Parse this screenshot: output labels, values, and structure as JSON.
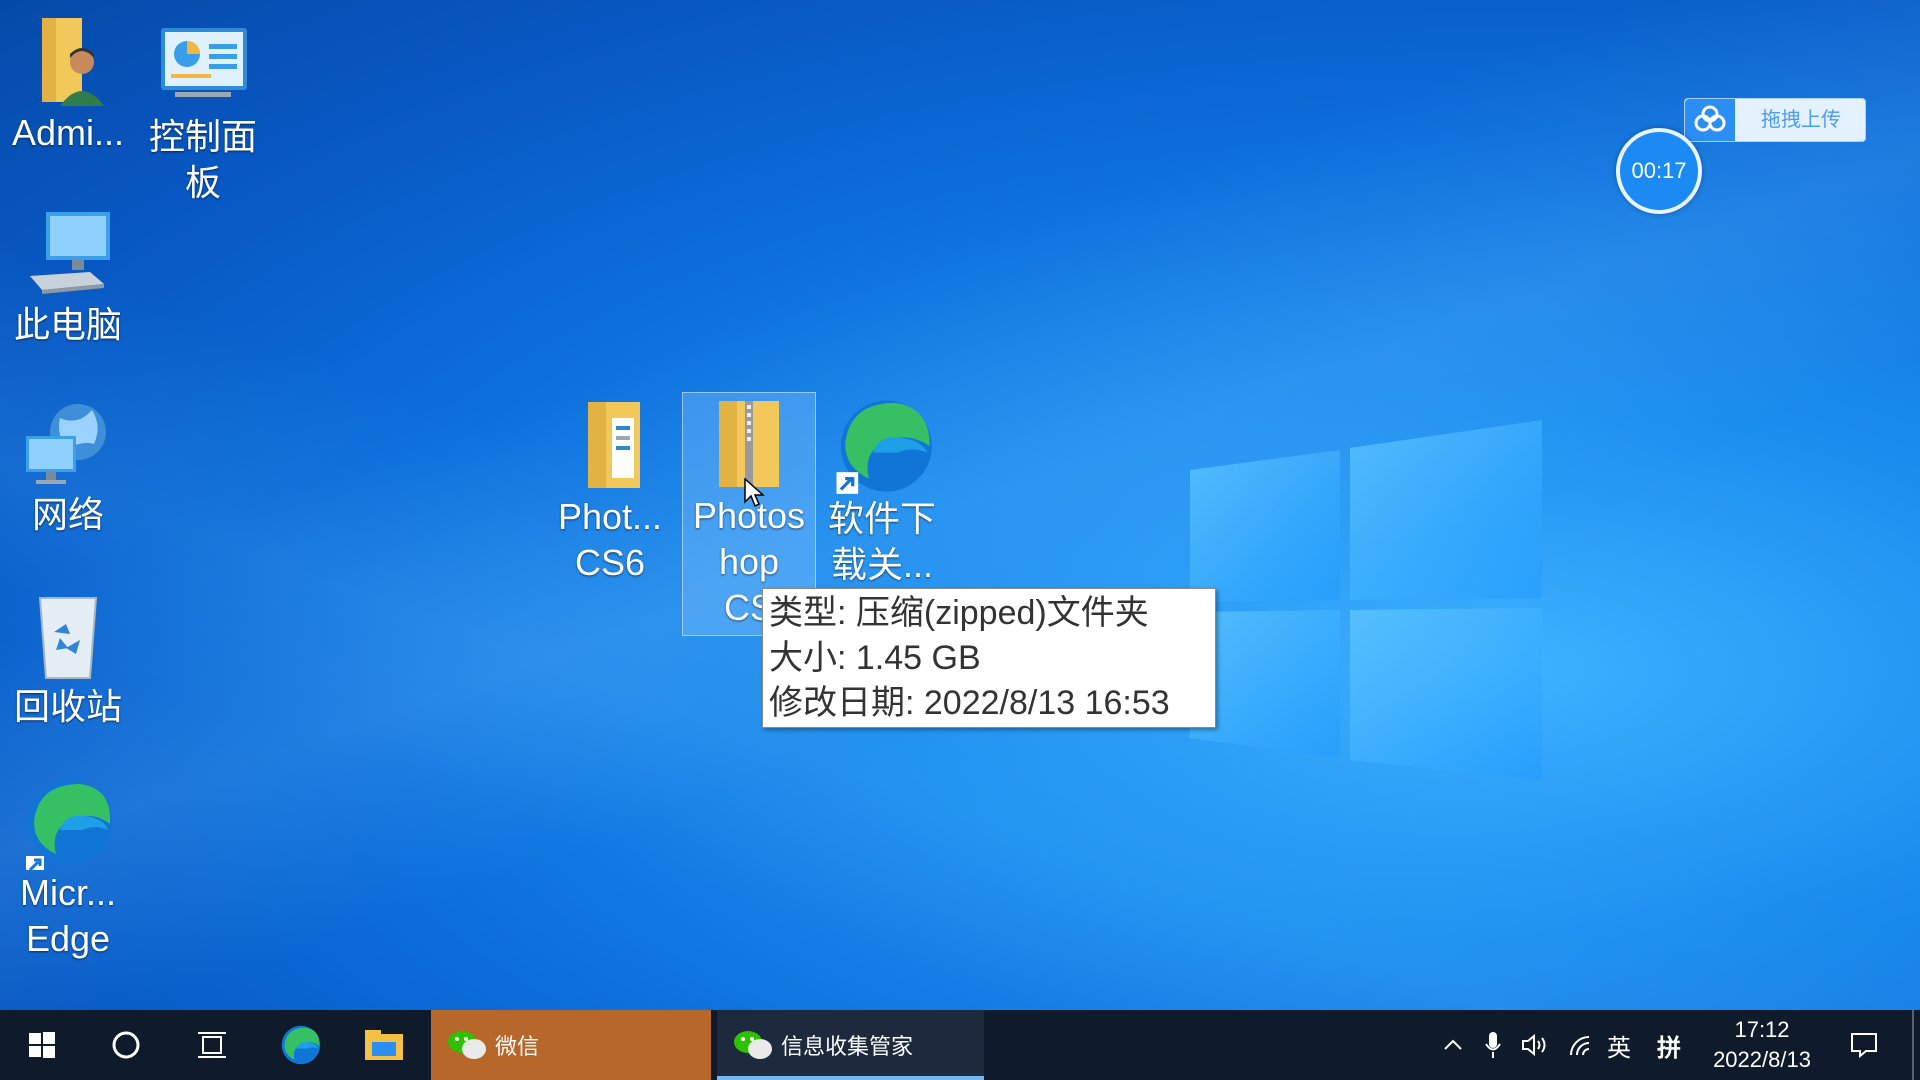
{
  "desktop": {
    "icons": [
      {
        "label": "Admi..."
      },
      {
        "label": "控制面\n板"
      },
      {
        "label": "此电脑"
      },
      {
        "label": "网络"
      },
      {
        "label": "回收站"
      },
      {
        "label": "Micr...\nEdge"
      },
      {
        "label": "Phot...\nCS6"
      },
      {
        "label": "Photos\nhop\nCS"
      },
      {
        "label": "软件下\n载关..."
      }
    ]
  },
  "tooltip": {
    "type_line": "类型: 压缩(zipped)文件夹",
    "size_line": "大小: 1.45 GB",
    "date_line": "修改日期: 2022/8/13 16:53"
  },
  "upload_widget": {
    "label": "拖拽上传"
  },
  "timer": {
    "value": "00:17"
  },
  "taskbar": {
    "apps": [
      {
        "label": "微信"
      },
      {
        "label": "信息收集管家"
      }
    ],
    "tray": {
      "lang": "英",
      "ime": "拼"
    },
    "clock": {
      "time": "17:12",
      "date": "2022/8/13"
    }
  },
  "colors": {
    "desktop_blue": "#0c6fdc",
    "taskbar": "#0f1a2b",
    "wechat_active": "#b8672b",
    "info_underline": "#76b9ed"
  }
}
